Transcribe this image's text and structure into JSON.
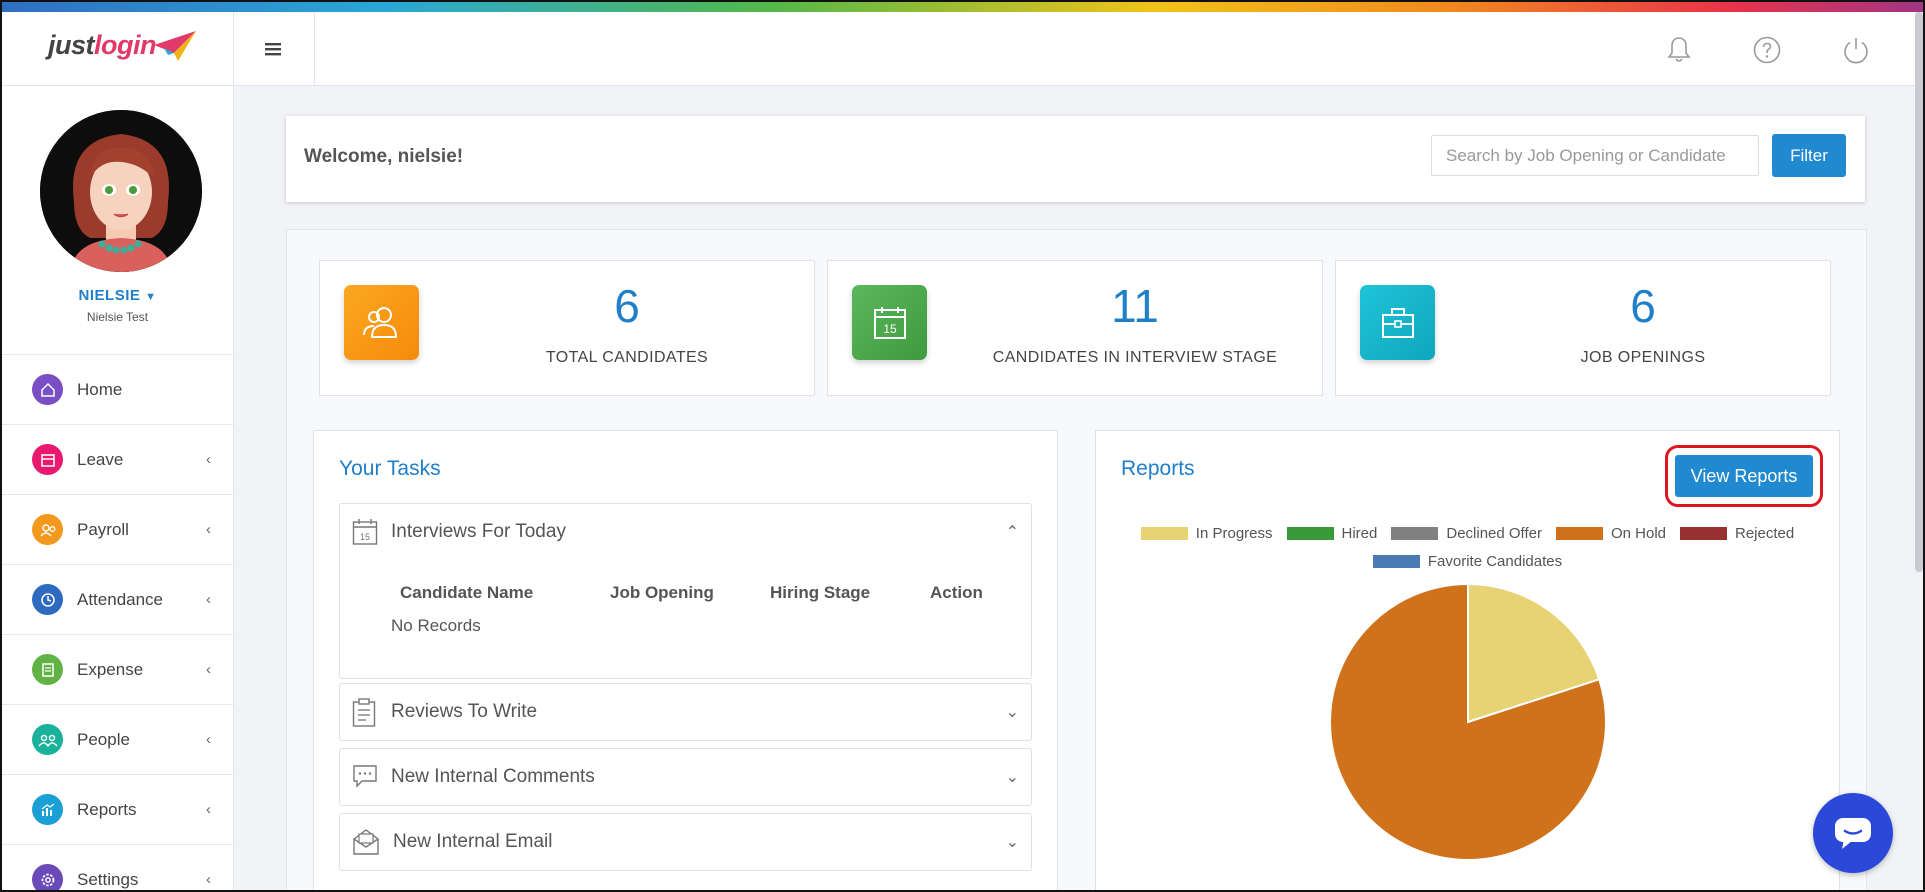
{
  "app": {
    "logo_text_a": "just",
    "logo_text_b": "login"
  },
  "topbar": {
    "icons": [
      "bell-icon",
      "help-icon",
      "power-icon"
    ]
  },
  "user": {
    "name": "NIELSIE",
    "subtitle": "Nielsie Test"
  },
  "sidebar": {
    "items": [
      {
        "label": "Home",
        "icon": "home-icon",
        "color": "#7a4fc6",
        "expandable": false
      },
      {
        "label": "Leave",
        "icon": "calendar-icon",
        "color": "#e8196e",
        "expandable": true
      },
      {
        "label": "Payroll",
        "icon": "payroll-icon",
        "color": "#f39a1e",
        "expandable": true
      },
      {
        "label": "Attendance",
        "icon": "clock-icon",
        "color": "#2e6bc0",
        "expandable": true
      },
      {
        "label": "Expense",
        "icon": "receipt-icon",
        "color": "#62b346",
        "expandable": true
      },
      {
        "label": "People",
        "icon": "people-icon",
        "color": "#1bb29c",
        "expandable": true
      },
      {
        "label": "Reports",
        "icon": "chart-icon",
        "color": "#1a9fd6",
        "expandable": true
      },
      {
        "label": "Settings",
        "icon": "gear-icon",
        "color": "#6a4ab8",
        "expandable": true
      }
    ]
  },
  "header": {
    "welcome": "Welcome, nielsie!",
    "search_placeholder": "Search by Job Opening or Candidate",
    "filter_label": "Filter"
  },
  "stats": [
    {
      "value": "6",
      "label": "TOTAL CANDIDATES",
      "icon": "users-icon",
      "color": "#f7930f"
    },
    {
      "value": "11",
      "label": "CANDIDATES IN INTERVIEW STAGE",
      "icon": "calendar-15-icon",
      "color": "#4ca64c"
    },
    {
      "value": "6",
      "label": "JOB OPENINGS",
      "icon": "briefcase-icon",
      "color": "#14b2c9"
    }
  ],
  "tasks": {
    "title": "Your Tasks",
    "sections": [
      {
        "title": "Interviews For Today",
        "expanded": true,
        "columns": [
          "Candidate Name",
          "Job Opening",
          "Hiring Stage",
          "Action"
        ],
        "empty_text": "No Records"
      },
      {
        "title": "Reviews To Write",
        "expanded": false
      },
      {
        "title": "New Internal Comments",
        "expanded": false
      },
      {
        "title": "New Internal Email",
        "expanded": false
      }
    ]
  },
  "reports": {
    "title": "Reports",
    "button_label": "View Reports"
  },
  "chart_data": {
    "type": "pie",
    "legend_placement": "top",
    "series": [
      {
        "name": "In Progress",
        "value": 1,
        "color": "#e8d374"
      },
      {
        "name": "Hired",
        "value": 0,
        "color": "#3a9a3a"
      },
      {
        "name": "Declined Offer",
        "value": 0,
        "color": "#808080"
      },
      {
        "name": "On Hold",
        "value": 4,
        "color": "#cf721b"
      },
      {
        "name": "Rejected",
        "value": 0,
        "color": "#983232"
      },
      {
        "name": "Favorite Candidates",
        "value": 0,
        "color": "#4a7bb5"
      }
    ]
  }
}
